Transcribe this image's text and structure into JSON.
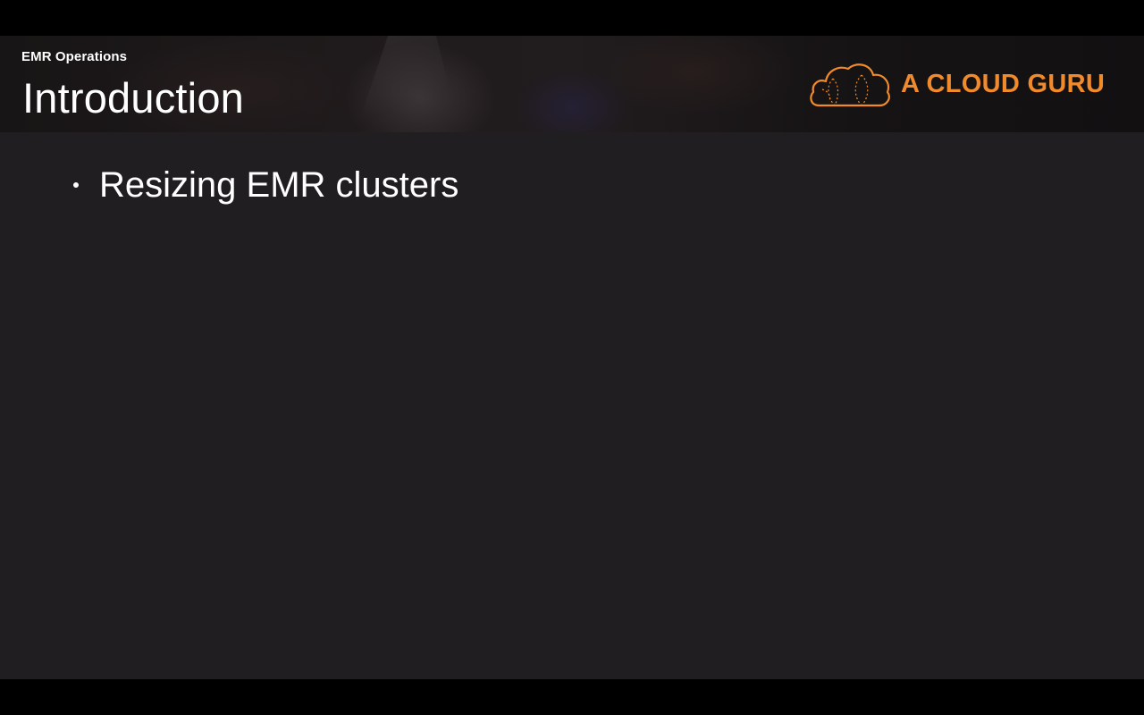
{
  "header": {
    "course_label": "EMR Operations",
    "section_title": "Introduction"
  },
  "brand": {
    "name": "A CLOUD GURU",
    "logo_icon": "cloud-logo-icon",
    "accent_color": "#f08a2a"
  },
  "slide": {
    "background_color": "#201e21",
    "bullets": [
      {
        "text": "Resizing EMR clusters"
      }
    ]
  }
}
